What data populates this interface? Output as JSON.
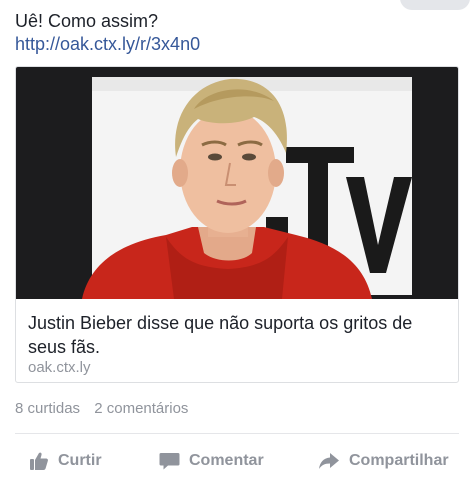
{
  "post": {
    "text": "Uê! Como assim?",
    "link": "http://oak.ctx.ly/r/3x4n0"
  },
  "link_card": {
    "image_alt": "Photo of a blond young man in a red hoodie in front of the MTV logo",
    "title": "Justin Bieber disse que não suporta os gritos de seus fãs.",
    "domain": "oak.ctx.ly"
  },
  "engagement": {
    "likes": "8 curtidas",
    "comments": "2 comentários"
  },
  "actions": {
    "like": {
      "label": "Curtir",
      "icon": "thumbs-up-icon"
    },
    "comment": {
      "label": "Comentar",
      "icon": "speech-bubble-icon"
    },
    "share": {
      "label": "Compartilhar",
      "icon": "share-arrow-icon"
    }
  },
  "colors": {
    "link": "#365899",
    "muted": "#90949c",
    "text": "#1d2129",
    "hoodie": "#c8261b"
  }
}
